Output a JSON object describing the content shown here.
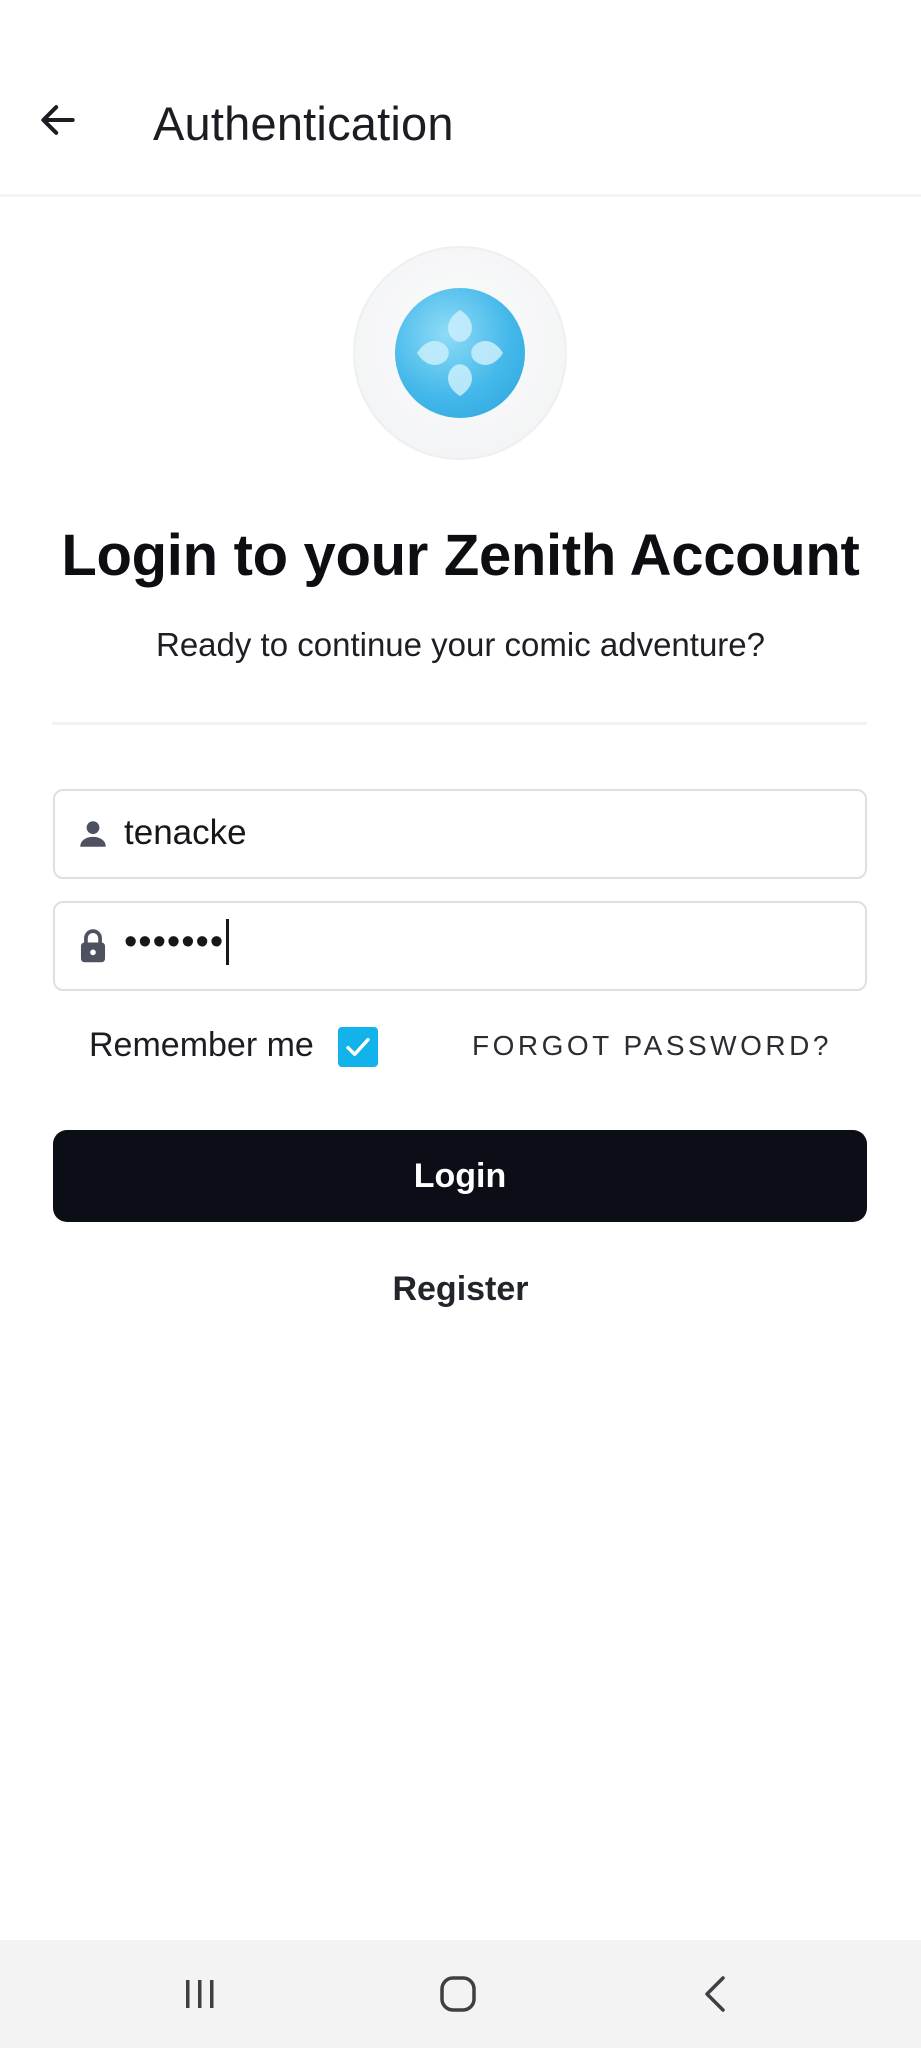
{
  "header": {
    "title": "Authentication",
    "back_icon": "arrow-left-icon"
  },
  "logo": {
    "icon": "four-petal-logo-icon",
    "accent_color": "#44b8ea"
  },
  "login": {
    "heading": "Login to your Zenith Account",
    "subheading": "Ready to continue your comic adventure?",
    "username": {
      "icon": "person-icon",
      "value": "tenacke"
    },
    "password": {
      "icon": "lock-icon",
      "masked_value": "•••••••"
    },
    "remember_me": {
      "label": "Remember me",
      "checked": true,
      "color": "#12b3eb"
    },
    "forgot_password_label": "FORGOT PASSWORD?",
    "login_button_label": "Login",
    "register_label": "Register",
    "button_color": "#0b0e16"
  },
  "system_nav": {
    "recents_icon": "recents-icon",
    "home_icon": "home-icon",
    "back_icon": "system-back-icon"
  }
}
